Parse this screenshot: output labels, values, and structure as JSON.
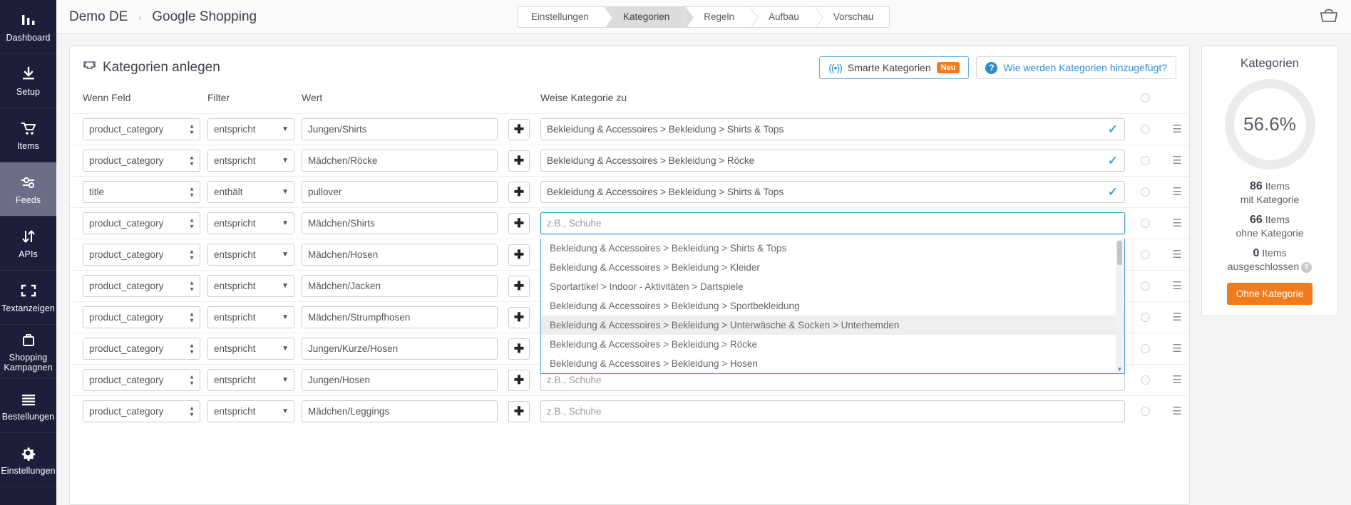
{
  "sidebar": {
    "items": [
      {
        "label": "Dashboard",
        "icon": "bar-chart-icon",
        "active": false
      },
      {
        "label": "Setup",
        "icon": "download-icon",
        "active": false
      },
      {
        "label": "Items",
        "icon": "shopping-cart-icon",
        "active": false
      },
      {
        "label": "Feeds",
        "icon": "sliders-icon",
        "active": true
      },
      {
        "label": "APIs",
        "icon": "exchange-arrows-icon",
        "active": false
      },
      {
        "label": "Textanzeigen",
        "icon": "expand-frame-icon",
        "active": false
      },
      {
        "label": "Shopping Kampagnen",
        "icon": "briefcase-icon",
        "active": false
      },
      {
        "label": "Bestellungen",
        "icon": "list-lines-icon",
        "active": false
      },
      {
        "label": "Einstellungen",
        "icon": "gear-icon",
        "active": false
      }
    ]
  },
  "topbar": {
    "breadcrumb_account": "Demo DE",
    "breadcrumb_separator": "›",
    "breadcrumb_page": "Google Shopping",
    "wizard": [
      {
        "label": "Einstellungen",
        "active": false
      },
      {
        "label": "Kategorien",
        "active": true
      },
      {
        "label": "Regeln",
        "active": false
      },
      {
        "label": "Aufbau",
        "active": false
      },
      {
        "label": "Vorschau",
        "active": false
      }
    ],
    "right_icon": "google-shopping-bag-icon"
  },
  "card": {
    "title": "Kategorien anlegen",
    "title_icon": "inbox-icon",
    "smart_button": {
      "label": "Smarte Kategorien",
      "badge": "Neu",
      "icon": "broadcast-icon"
    },
    "help_button": {
      "label": "Wie werden Kategorien hinzugefügt?",
      "icon": "question-circle-icon"
    },
    "columns": [
      "Wenn Feld",
      "Filter",
      "Wert",
      "Weise Kategorie zu"
    ],
    "category_placeholder": "z.B., Schuhe",
    "rows": [
      {
        "field": "product_category",
        "filter": "entspricht",
        "value": "Jungen/Shirts",
        "category": "Bekleidung & Accessoires > Bekleidung > Shirts & Tops",
        "assigned": true,
        "focused": false
      },
      {
        "field": "product_category",
        "filter": "entspricht",
        "value": "Mädchen/Röcke",
        "category": "Bekleidung & Accessoires > Bekleidung > Röcke",
        "assigned": true,
        "focused": false
      },
      {
        "field": "title",
        "filter": "enthält",
        "value": "pullover",
        "category": "Bekleidung & Accessoires > Bekleidung > Shirts & Tops",
        "assigned": true,
        "focused": false
      },
      {
        "field": "product_category",
        "filter": "entspricht",
        "value": "Mädchen/Shirts",
        "category": "",
        "assigned": false,
        "focused": true
      },
      {
        "field": "product_category",
        "filter": "entspricht",
        "value": "Mädchen/Hosen",
        "category": "",
        "assigned": false,
        "focused": false
      },
      {
        "field": "product_category",
        "filter": "entspricht",
        "value": "Mädchen/Jacken",
        "category": "",
        "assigned": false,
        "focused": false
      },
      {
        "field": "product_category",
        "filter": "entspricht",
        "value": "Mädchen/Strumpfhosen",
        "category": "",
        "assigned": false,
        "focused": false
      },
      {
        "field": "product_category",
        "filter": "entspricht",
        "value": "Jungen/Kurze/Hosen",
        "category": "",
        "assigned": false,
        "focused": false
      },
      {
        "field": "product_category",
        "filter": "entspricht",
        "value": "Jungen/Hosen",
        "category": "",
        "assigned": false,
        "focused": false
      },
      {
        "field": "product_category",
        "filter": "entspricht",
        "value": "Mädchen/Leggings",
        "category": "",
        "assigned": false,
        "focused": false
      }
    ],
    "dropdown": {
      "open_on_row": 3,
      "items": [
        {
          "label": "Bekleidung & Accessoires > Bekleidung > Shirts & Tops",
          "highlighted": false
        },
        {
          "label": "Bekleidung & Accessoires > Bekleidung > Kleider",
          "highlighted": false
        },
        {
          "label": "Sportartikel > Indoor - Aktivitäten > Dartspiele",
          "highlighted": false
        },
        {
          "label": "Bekleidung & Accessoires > Bekleidung > Sportbekleidung",
          "highlighted": false
        },
        {
          "label": "Bekleidung & Accessoires > Bekleidung > Unterwäsche & Socken > Unterhemden",
          "highlighted": true
        },
        {
          "label": "Bekleidung & Accessoires > Bekleidung > Röcke",
          "highlighted": false
        },
        {
          "label": "Bekleidung & Accessoires > Bekleidung > Hosen",
          "highlighted": false
        }
      ]
    }
  },
  "side_panel": {
    "title": "Kategorien",
    "percent": "56.6%",
    "stats": [
      {
        "number": "86",
        "unit": "Items",
        "desc": "mit Kategorie",
        "help": false
      },
      {
        "number": "66",
        "unit": "Items",
        "desc": "ohne Kategorie",
        "help": false
      },
      {
        "number": "0",
        "unit": "Items",
        "desc": "ausgeschlossen",
        "help": true
      }
    ],
    "button": "Ohne Kategorie"
  },
  "colors": {
    "sidebar_bg": "#1d1f3a",
    "accent_blue": "#2a8fd0",
    "accent_orange": "#f07c1d",
    "focus_blue": "#3fa0dc"
  }
}
